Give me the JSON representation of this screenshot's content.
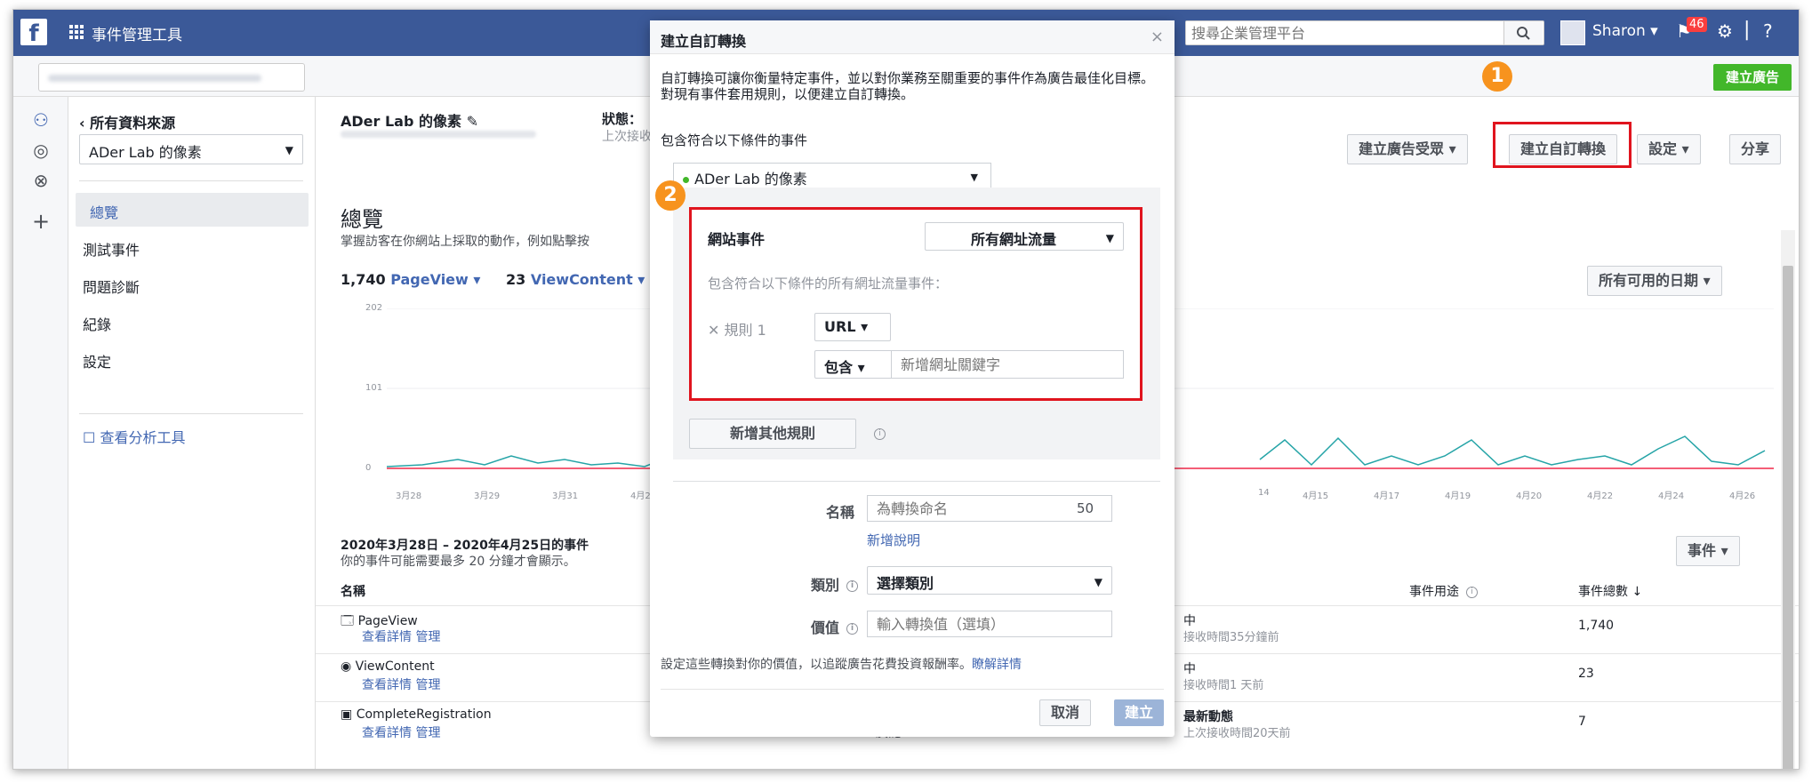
{
  "topbar": {
    "app_title": "事件管理工具",
    "search_placeholder": "搜尋企業管理平台",
    "user_name": "Sharon ▾",
    "notification_count": "46"
  },
  "subbar": {
    "create_ad_label": "建立廣告",
    "badge_1": "1"
  },
  "sidebar": {
    "back_label": "‹ 所有資料來源",
    "source_select": "ADer Lab 的像素",
    "items": [
      {
        "label": "總覽"
      },
      {
        "label": "測試事件"
      },
      {
        "label": "問題診斷"
      },
      {
        "label": "紀錄"
      },
      {
        "label": "設定"
      }
    ],
    "analytics_link": "查看分析工具"
  },
  "main": {
    "pixel_title": "ADer Lab 的像素",
    "status_label": "狀態：",
    "status_sub": "上次接收",
    "buttons": {
      "custom_audience": "建立廣告受眾 ▾",
      "custom_conversion": "建立自訂轉換",
      "settings": "設定 ▾",
      "share": "分享"
    },
    "overview_title": "總覽",
    "overview_desc": "掌握訪客在你網站上採取的動作，例如點擊按",
    "metrics": {
      "pageview_count": "1,740",
      "pageview_label": "PageView ▾",
      "viewcontent_count": "23",
      "viewcontent_label": "ViewContent ▾"
    },
    "date_range_button": "所有可用的日期 ▾",
    "y_ticks": [
      "202",
      "101",
      "0"
    ],
    "x_ticks_left": [
      "3月28",
      "3月29",
      "3月31",
      "4月2"
    ],
    "x_ticks_right": [
      "14",
      "4月15",
      "4月17",
      "4月19",
      "4月20",
      "4月22",
      "4月24",
      "4月26"
    ],
    "events_title": "2020年3月28日 – 2020年4月25日的事件",
    "events_desc": "你的事件可能需要最多 20 分鐘才會顯示。",
    "events_button": "事件 ▾",
    "table_headers": {
      "name": "名稱",
      "usage": "事件用途",
      "total": "事件總數 ↓"
    },
    "rows": [
      {
        "icon": "page-icon",
        "name": "PageView",
        "links": "查看詳情 管理",
        "status": "中",
        "status_sub": "接收時間35分鐘前",
        "total": "1,740"
      },
      {
        "icon": "eye-icon",
        "name": "ViewContent",
        "links": "查看詳情 管理",
        "status": "中",
        "status_sub": "接收時間1 天前",
        "total": "23"
      },
      {
        "icon": "registration-icon",
        "name": "CompleteRegistration",
        "links": "查看詳情 管理",
        "status": "最新動態",
        "status_sub": "上次接收時間20天前",
        "total": "7",
        "mid_text": "廣泛"
      }
    ]
  },
  "modal": {
    "title": "建立自訂轉換",
    "description": "自訂轉換可讓你衡量特定事件，並以對你業務至關重要的事件作為廣告最佳化目標。對現有事件套用規則，以便建立自訂轉換。",
    "include_label": "包含符合以下條件的事件",
    "pixel_select": "ADer Lab 的像素",
    "badge_2": "2",
    "website_event_label": "網站事件",
    "traffic_select": "所有網址流量",
    "traffic_desc": "包含符合以下條件的所有網址流量事件：",
    "rule_label": "規則 1",
    "url_select": "URL ▾",
    "contains_select": "包含 ▾",
    "keyword_placeholder": "新增網址關鍵字",
    "add_rule_button": "新增其他規則",
    "name_label": "名稱",
    "name_placeholder": "為轉換命名",
    "name_counter": "50",
    "add_desc_link": "新增說明",
    "category_label": "類別",
    "category_select": "選擇類別",
    "value_label": "價值",
    "value_placeholder": "輸入轉換值（選填）",
    "value_help": "設定這些轉換對你的價值，以追蹤廣告花費投資報酬率。",
    "learn_more": "瞭解詳情",
    "cancel_button": "取消",
    "create_button": "建立"
  },
  "colors": {
    "brand": "#3b5998",
    "highlight": "#e0141e",
    "badge": "#f7931e",
    "create_ad": "#42b72a"
  }
}
